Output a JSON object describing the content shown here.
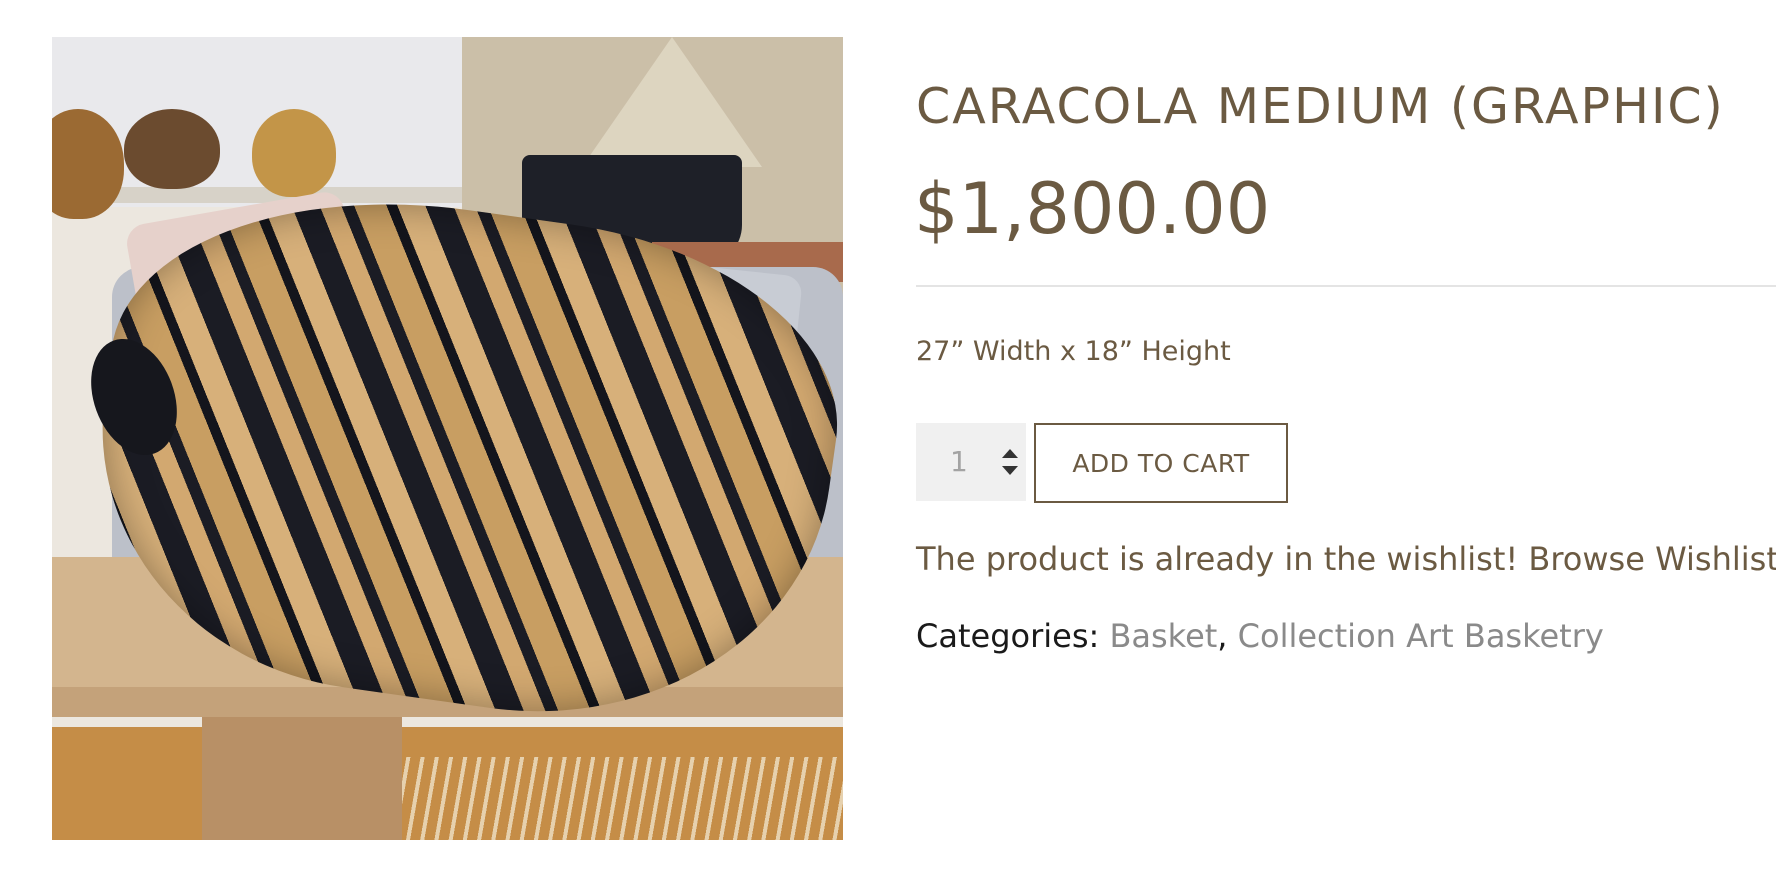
{
  "product": {
    "image_alt": "Caracola Medium (Graphic) woven basket on a wooden table",
    "title": "CARACOLA MEDIUM (GRAPHIC)",
    "price": "$1,800.00",
    "dimensions": "27” Width x 18” Height",
    "quantity": "1",
    "add_to_cart_label": "ADD TO CART",
    "wishlist_message": "The product is already in the wishlist!",
    "wishlist_link_label": "Browse Wishlist",
    "categories_label": "Categories:",
    "categories": [
      {
        "label": "Basket"
      },
      {
        "label": "Collection Art Basketry"
      }
    ],
    "category_separator": ","
  },
  "colors": {
    "text_brown": "#6b5a42",
    "link_grey": "#8a8a8a",
    "quantity_bg": "#f0f0f0",
    "divider": "#e4e4e4"
  }
}
